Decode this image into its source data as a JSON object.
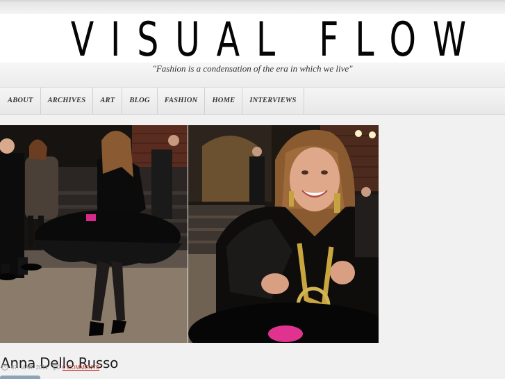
{
  "site": {
    "title": "VISUAL FLOW",
    "tagline": "\"Fashion is a condensation of the era in which we live\""
  },
  "nav": {
    "items": [
      {
        "label": "ABOUT"
      },
      {
        "label": "ARCHIVES"
      },
      {
        "label": "ART"
      },
      {
        "label": "BLOG"
      },
      {
        "label": "FASHION"
      },
      {
        "label": "HOME"
      },
      {
        "label": "INTERVIEWS"
      }
    ]
  },
  "post": {
    "title": "Anna Dello Russo",
    "date": "07. MAR. 2011",
    "comments": "0 COMMENTS"
  },
  "icons": {
    "clock": "clock-icon",
    "comment": "comment-icon"
  }
}
